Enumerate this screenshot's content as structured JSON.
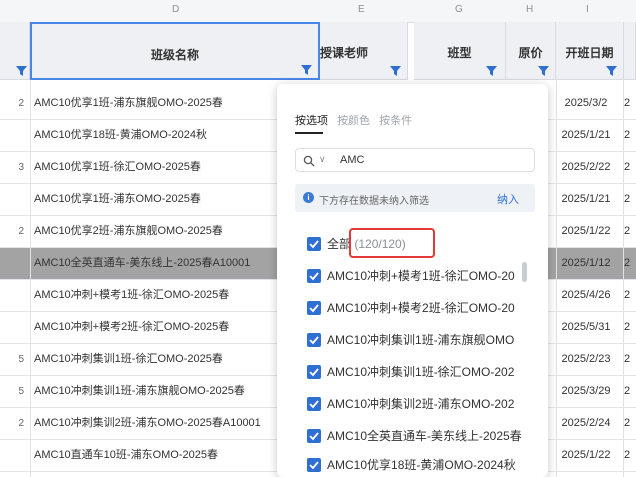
{
  "columns": {
    "letters": [
      "D",
      "E",
      "G",
      "H",
      "I"
    ],
    "headers": {
      "class_name": "班级名称",
      "teacher": "授课老师",
      "class_type": "班型",
      "price": "原价",
      "start_date": "开班日期"
    }
  },
  "rows": [
    {
      "lead": "2",
      "name": "AMC10优享1班-浦东旗舰OMO-2025春",
      "date": "2025/3/2",
      "cut": "2"
    },
    {
      "lead": "",
      "name": "AMC10优享18班-黄浦OMO-2024秋",
      "date": "2025/1/21",
      "cut": "2"
    },
    {
      "lead": "3",
      "name": "AMC10优享1班-徐汇OMO-2025春",
      "date": "2025/2/22",
      "cut": "2"
    },
    {
      "lead": "",
      "name": "AMC10优享1班-浦东OMO-2025春",
      "date": "2025/1/21",
      "cut": "2"
    },
    {
      "lead": "2",
      "name": "AMC10优享2班-浦东旗舰OMO-2025春",
      "date": "2025/1/22",
      "cut": "2"
    },
    {
      "lead": "",
      "name": "AMC10全英直通车-美东线上-2025春A10001",
      "date": "2025/1/12",
      "cut": "2"
    },
    {
      "lead": "",
      "name": "AMC10冲刺+模考1班-徐汇OMO-2025春",
      "date": "2025/4/26",
      "cut": "2"
    },
    {
      "lead": "",
      "name": "AMC10冲刺+模考2班-徐汇OMO-2025春",
      "date": "2025/5/31",
      "cut": "2"
    },
    {
      "lead": "5",
      "name": "AMC10冲刺集训1班-徐汇OMO-2025春",
      "date": "2025/2/23",
      "cut": "2"
    },
    {
      "lead": "5",
      "name": "AMC10冲刺集训1班-浦东旗舰OMO-2025春",
      "date": "2025/3/29",
      "cut": "2"
    },
    {
      "lead": "2",
      "name": "AMC10冲刺集训2班-浦东OMO-2025春A10001",
      "date": "2025/2/24",
      "cut": "2"
    },
    {
      "lead": "",
      "name": "AMC10直通车10班-浦东OMO-2025春",
      "date": "2025/1/22",
      "cut": "2"
    }
  ],
  "popup": {
    "tabs": [
      "按选项",
      "按颜色",
      "按条件"
    ],
    "search_value": "AMC",
    "notice_text": "下方存在数据未纳入筛选",
    "notice_link": "纳入",
    "select_all_label": "全部",
    "select_all_count": "(120/120)",
    "options": [
      "AMC10冲刺+模考1班-徐汇OMO-20",
      "AMC10冲刺+模考2班-徐汇OMO-20",
      "AMC10冲刺集训1班-浦东旗舰OMO",
      "AMC10冲刺集训1班-徐汇OMO-202",
      "AMC10冲刺集训2班-浦东OMO-202",
      "AMC10全英直通车-美东线上-2025春",
      "AMC10优享18班-黄浦OMO-2024秋"
    ]
  },
  "colors": {
    "accent": "#2f6fd1",
    "highlight_row": "#a3a3a3",
    "red_box": "#e53935"
  },
  "icons": {
    "filter": "filter-funnel-icon",
    "search": "search-icon",
    "info": "info-icon",
    "check": "check-icon"
  }
}
